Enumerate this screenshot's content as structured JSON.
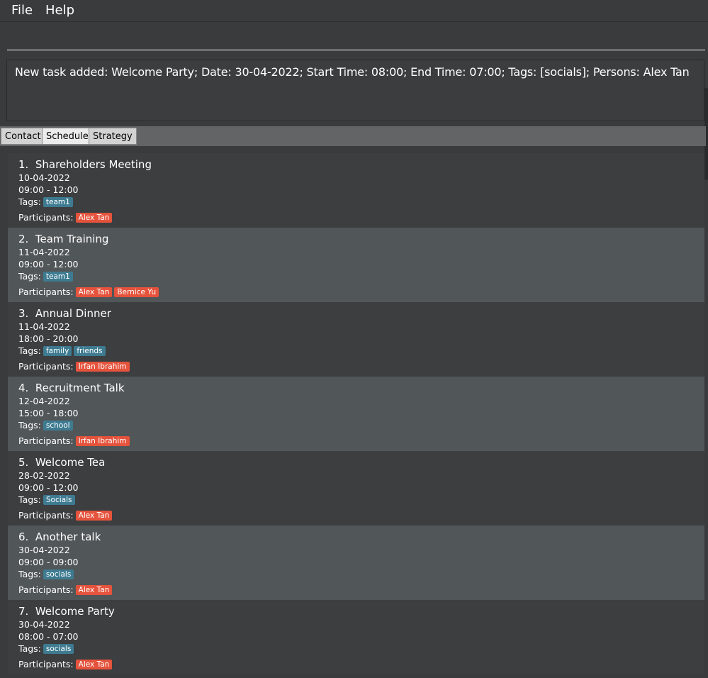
{
  "menu": {
    "file": "File",
    "help": "Help"
  },
  "command": {
    "value": "",
    "placeholder": ""
  },
  "result": "New task added: Welcome Party; Date: 30-04-2022; Start Time: 08:00; End Time: 07:00; Tags: [socials]; Persons: Alex Tan",
  "tabs": [
    {
      "label": "Contact",
      "active": false
    },
    {
      "label": "Schedule",
      "active": true
    },
    {
      "label": "Strategy",
      "active": false
    }
  ],
  "labels": {
    "tags": "Tags:",
    "participants": "Participants:"
  },
  "tasks": [
    {
      "index": "1.",
      "name": "Shareholders Meeting",
      "date": "10-04-2022",
      "time": "09:00 - 12:00",
      "tags": [
        "team1"
      ],
      "participants": [
        "Alex Tan"
      ]
    },
    {
      "index": "2.",
      "name": "Team Training",
      "date": "11-04-2022",
      "time": "09:00 - 12:00",
      "tags": [
        "team1"
      ],
      "participants": [
        "Alex Tan",
        "Bernice Yu"
      ]
    },
    {
      "index": "3.",
      "name": "Annual Dinner",
      "date": "11-04-2022",
      "time": "18:00 - 20:00",
      "tags": [
        "family",
        "friends"
      ],
      "participants": [
        "Irfan Ibrahim"
      ]
    },
    {
      "index": "4.",
      "name": "Recruitment Talk",
      "date": "12-04-2022",
      "time": "15:00 - 18:00",
      "tags": [
        "school"
      ],
      "participants": [
        "Irfan Ibrahim"
      ]
    },
    {
      "index": "5.",
      "name": "Welcome Tea",
      "date": "28-02-2022",
      "time": "09:00 - 12:00",
      "tags": [
        "Socials"
      ],
      "participants": [
        "Alex Tan"
      ]
    },
    {
      "index": "6.",
      "name": "Another talk",
      "date": "30-04-2022",
      "time": "09:00 - 09:00",
      "tags": [
        "socials"
      ],
      "participants": [
        "Alex Tan"
      ]
    },
    {
      "index": "7.",
      "name": "Welcome Party",
      "date": "30-04-2022",
      "time": "08:00 - 07:00",
      "tags": [
        "socials"
      ],
      "participants": [
        "Alex Tan"
      ]
    }
  ],
  "colors": {
    "tag": "#3e7b91",
    "person": "#e5533c",
    "card_odd": "#3c3e40",
    "card_even": "#515658"
  }
}
